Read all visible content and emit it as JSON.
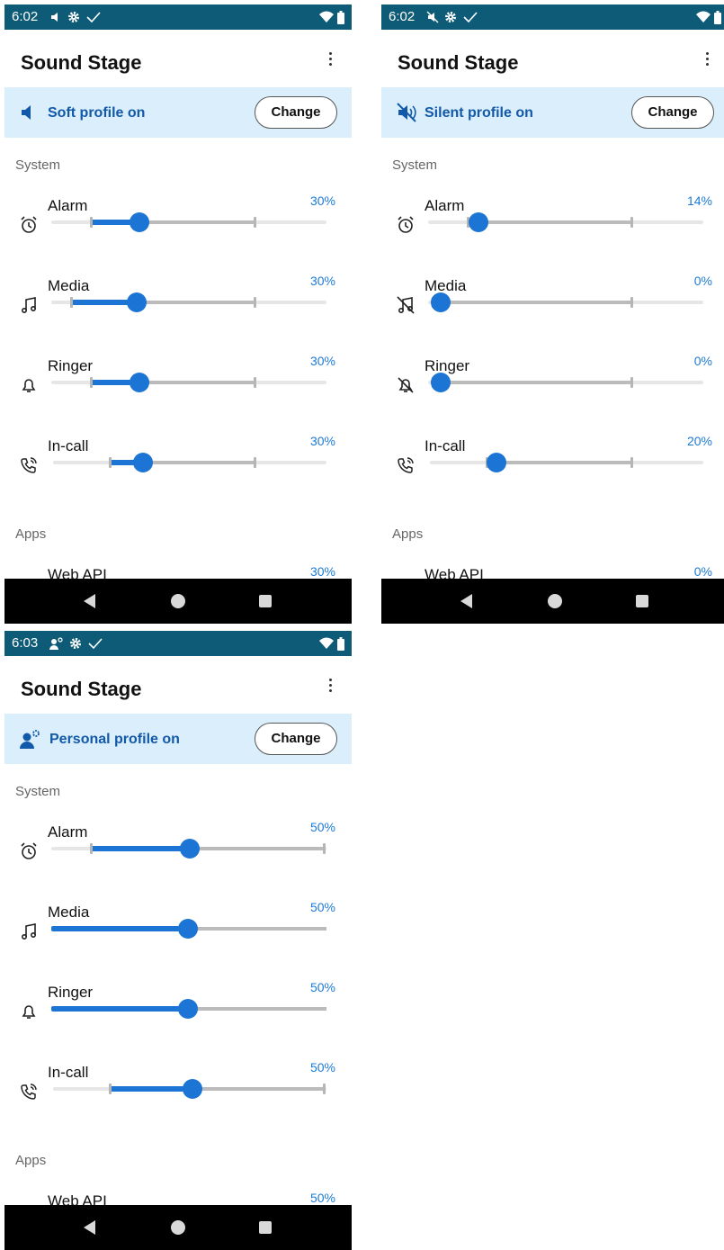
{
  "app_title": "Sound Stage",
  "change_label": "Change",
  "section_system": "System",
  "section_apps": "Apps",
  "colors": {
    "statusbar": "#0e5b77",
    "banner": "#dbeefb",
    "accent": "#1c74d4",
    "banner_text": "#1259a8"
  },
  "screens": [
    {
      "time": "6:02",
      "status_icons": [
        "volume-icon",
        "gear-icon",
        "check-icon"
      ],
      "profile_icon": "speaker-icon",
      "profile_text": "Soft profile on",
      "sliders": [
        {
          "label": "Alarm",
          "icon": "alarm-clock-icon",
          "pct": "30%",
          "value": 0.3
        },
        {
          "label": "Media",
          "icon": "music-note-icon",
          "pct": "30%",
          "value": 0.3
        },
        {
          "label": "Ringer",
          "icon": "bell-icon",
          "pct": "30%",
          "value": 0.3
        },
        {
          "label": "In-call",
          "icon": "phone-call-icon",
          "pct": "30%",
          "value": 0.3
        }
      ],
      "apps": [
        {
          "label": "Web API",
          "pct": "30%"
        }
      ]
    },
    {
      "time": "6:02",
      "status_icons": [
        "mute-icon",
        "gear-icon",
        "check-icon"
      ],
      "profile_icon": "speaker-muted-icon",
      "profile_text": "Silent profile on",
      "sliders": [
        {
          "label": "Alarm",
          "icon": "alarm-clock-icon",
          "pct": "14%",
          "value": 0.14
        },
        {
          "label": "Media",
          "icon": "music-note-off-icon",
          "pct": "0%",
          "value": 0.0
        },
        {
          "label": "Ringer",
          "icon": "bell-off-icon",
          "pct": "0%",
          "value": 0.0
        },
        {
          "label": "In-call",
          "icon": "phone-call-icon",
          "pct": "20%",
          "value": 0.2
        }
      ],
      "apps": [
        {
          "label": "Web API",
          "pct": "0%"
        }
      ]
    },
    {
      "time": "6:03",
      "status_icons": [
        "person-gear-icon",
        "gear-icon",
        "check-icon"
      ],
      "profile_icon": "person-gear-icon",
      "profile_text": "Personal profile on",
      "sliders": [
        {
          "label": "Alarm",
          "icon": "alarm-clock-icon",
          "pct": "50%",
          "value": 0.5
        },
        {
          "label": "Media",
          "icon": "music-note-icon",
          "pct": "50%",
          "value": 0.5
        },
        {
          "label": "Ringer",
          "icon": "bell-icon",
          "pct": "50%",
          "value": 0.5
        },
        {
          "label": "In-call",
          "icon": "phone-call-icon",
          "pct": "50%",
          "value": 0.5
        }
      ],
      "apps": [
        {
          "label": "Web API",
          "pct": "50%"
        }
      ]
    }
  ]
}
